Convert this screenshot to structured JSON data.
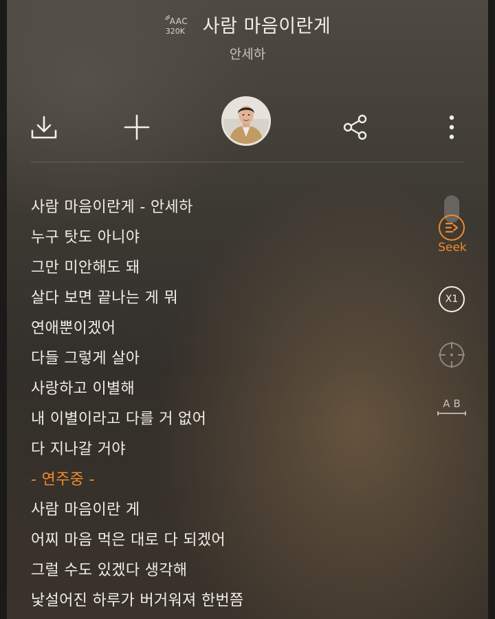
{
  "header": {
    "quality_format": "AAC",
    "quality_bitrate": "320K",
    "song_title": "사람 마음이란게",
    "artist": "안세하"
  },
  "toolbar": {
    "download_icon": "download-icon",
    "add_icon": "plus-icon",
    "avatar": "artist-avatar",
    "share_icon": "share-icon",
    "more_icon": "more-vertical-icon"
  },
  "lyrics": {
    "lines": [
      "사람 마음이란게 - 안세하",
      "누구 탓도 아니야",
      "그만 미안해도 돼",
      "살다 보면 끝나는 게 뭐",
      "연애뿐이겠어",
      "다들 그렇게 살아",
      "사랑하고 이별해",
      "내 이별이라고 다를 거 없어",
      "다 지나갈 거야",
      "- 연주중 -",
      "사람 마음이란 게",
      "어찌 마음 먹은 대로 다 되겠어",
      "그럴 수도 있겠다 생각해",
      "낯설어진 하루가 버거워져 한번쯤"
    ]
  },
  "controls": {
    "seek_label": "Seek",
    "speed_label": "X1",
    "ab_label": "AB"
  },
  "colors": {
    "accent": "#f08a2c",
    "text": "#f1eee8"
  }
}
